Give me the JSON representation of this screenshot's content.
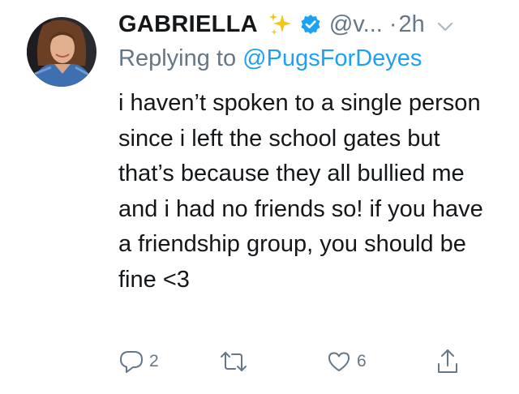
{
  "tweet": {
    "author_name": "GABRIELLA",
    "name_emoji": "sparkles-icon",
    "verified": true,
    "handle": "@v...",
    "separator": "·",
    "time": "2h",
    "replying_prefix": "Replying to",
    "replying_to": "@PugsForDeyes",
    "text": "i haven’t spoken to a single person since i left the school gates but that’s because they all bullied me and i had no friends so! if you have a friendship group, you should be fine <3",
    "actions": {
      "reply_count": "2",
      "retweet_count": "",
      "like_count": "6"
    }
  },
  "colors": {
    "accent": "#1da1f2",
    "secondary_text": "#657786",
    "primary_text": "#14171a",
    "sparkle": "#f5c518"
  }
}
